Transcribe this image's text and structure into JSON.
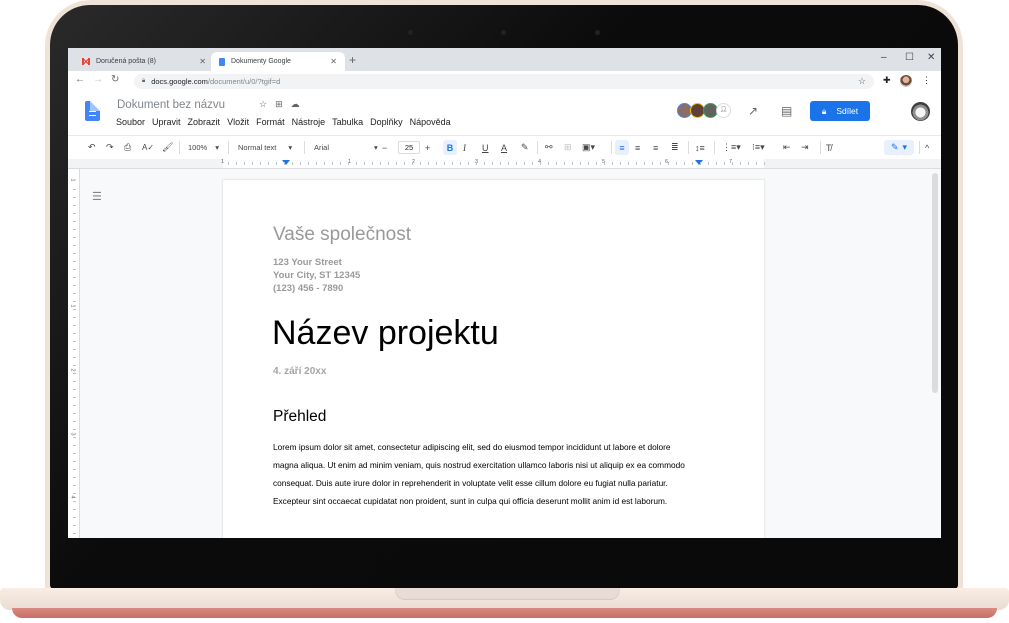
{
  "browser": {
    "tabs": [
      {
        "label": "Doručená pošta (8)",
        "icon": "gmail-icon",
        "active": false
      },
      {
        "label": "Dokumenty Google",
        "icon": "docs-icon",
        "active": true
      }
    ],
    "new_tab_label": "+",
    "url_host": "docs.google.com",
    "url_path": "/document/u/0/?tgif=d",
    "window_controls": {
      "minimize": "‒",
      "maximize": "☐",
      "close": "✕"
    }
  },
  "docs": {
    "title": "Dokument bez názvu",
    "menu": [
      "Soubor",
      "Upravit",
      "Zobrazit",
      "Vložit",
      "Formát",
      "Nástroje",
      "Tabulka",
      "Doplňky",
      "Nápověda"
    ],
    "share_label": "Sdílet",
    "collaborator_colors": [
      "#4285f4",
      "#fbbc04",
      "#34a853"
    ]
  },
  "toolbar": {
    "zoom": "100%",
    "style": "Normal text",
    "font": "Arial",
    "font_size": "25"
  },
  "ruler": {
    "horizontal_labels": [
      "1",
      "1",
      "2",
      "3",
      "4",
      "5",
      "6",
      "7"
    ],
    "vertical_labels": [
      "1",
      "1",
      "2",
      "3",
      "4"
    ]
  },
  "document": {
    "company": "Vaše společnost",
    "address": [
      "123 Your Street",
      "Your City, ST 12345",
      "(123) 456 - 7890"
    ],
    "project_title": "Název projektu",
    "date": "4. září 20xx",
    "heading": "Přehled",
    "paragraph_lines": [
      "Lorem ipsum dolor sit amet, consectetur adipiscing elit, sed do eiusmod tempor incididunt ut labore et dolore",
      "magna aliqua. Ut enim ad minim veniam, quis nostrud exercitation ullamco laboris nisi ut aliquip ex ea commodo",
      "consequat. Duis aute irure dolor in reprehenderit in voluptate velit esse cillum dolore eu fugiat nulla pariatur.",
      "Excepteur sint occaecat cupidatat non proident, sunt in culpa qui officia deserunt mollit anim id est laborum."
    ]
  }
}
